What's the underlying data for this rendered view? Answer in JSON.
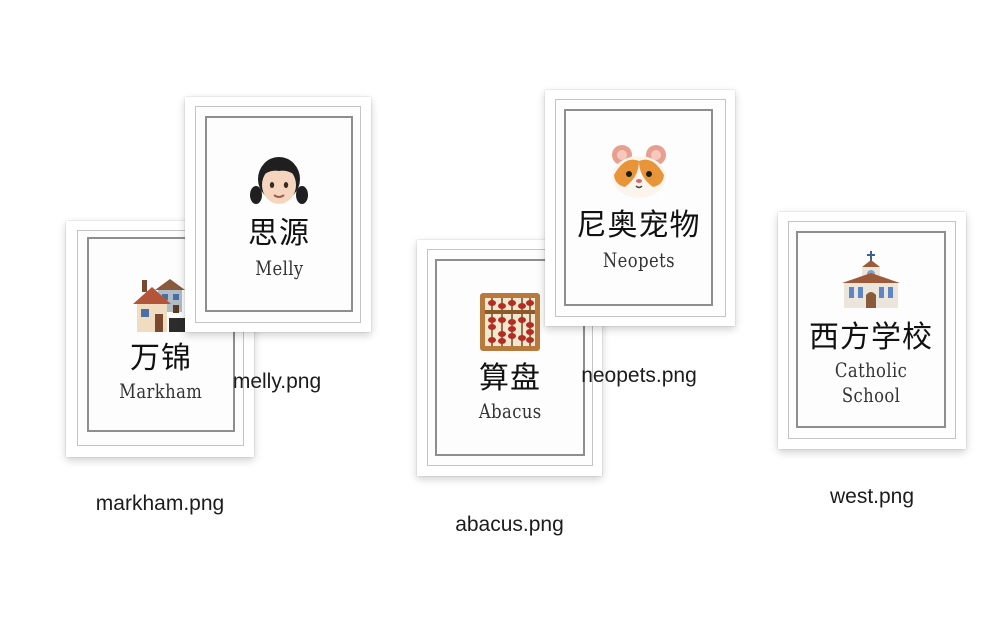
{
  "files": [
    {
      "id": "markham",
      "filename": "markham.png",
      "chinese": "万锦",
      "english": "Markham",
      "icon": "houses-icon"
    },
    {
      "id": "melly",
      "filename": "melly.png",
      "chinese": "思源",
      "english": "Melly",
      "icon": "girl-icon"
    },
    {
      "id": "abacus",
      "filename": "abacus.png",
      "chinese": "算盘",
      "english": "Abacus",
      "icon": "abacus-icon"
    },
    {
      "id": "neopets",
      "filename": "neopets.png",
      "chinese": "尼奥宠物",
      "english": "Neopets",
      "icon": "hamster-icon"
    },
    {
      "id": "west",
      "filename": "west.png",
      "chinese": "西方学校",
      "english_line1": "Catholic",
      "english_line2": "School",
      "icon": "church-icon"
    }
  ],
  "colors": {
    "background": "#ffffff",
    "frame_inner": "#8e8e8e",
    "frame_outer": "#c4c4c4",
    "text": "#111111"
  }
}
